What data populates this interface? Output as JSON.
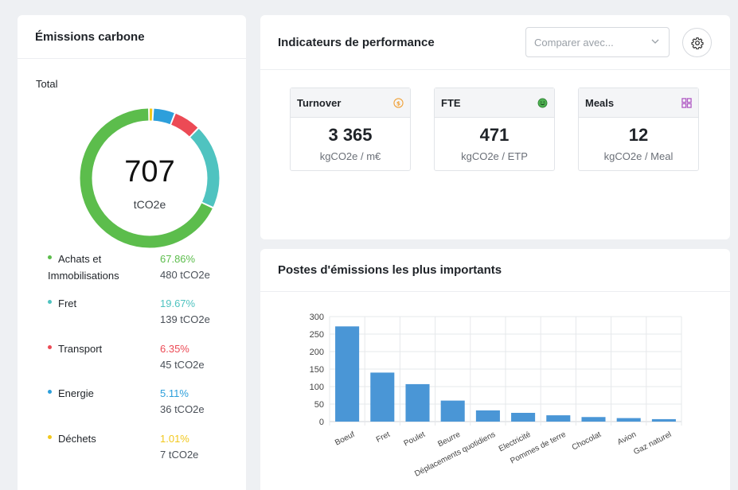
{
  "emissions": {
    "title": "Émissions carbone",
    "total_label": "Total",
    "total_value": "707",
    "total_unit": "tCO2e",
    "items": [
      {
        "name": "Achats et Immobilisations",
        "pct": "67.86%",
        "abs": "480 tCO2e",
        "color": "#5cbd4c",
        "share": 0.6786
      },
      {
        "name": "Fret",
        "pct": "19.67%",
        "abs": "139 tCO2e",
        "color": "#4fc3c0",
        "share": 0.1967
      },
      {
        "name": "Transport",
        "pct": "6.35%",
        "abs": "45 tCO2e",
        "color": "#ec4a55",
        "share": 0.0635
      },
      {
        "name": "Energie",
        "pct": "5.11%",
        "abs": "36 tCO2e",
        "color": "#2d9fdb",
        "share": 0.0511
      },
      {
        "name": "Déchets",
        "pct": "1.01%",
        "abs": "7 tCO2e",
        "color": "#f2c81d",
        "share": 0.0101
      }
    ]
  },
  "kpi": {
    "title": "Indicateurs de performance",
    "compare_placeholder": "Comparer avec...",
    "settings_icon": "gear-icon",
    "cards": [
      {
        "label": "Turnover",
        "value": "3 365",
        "unit": "kgCO2e / m€",
        "icon": "dollar-coin-icon",
        "icon_color": "#f0a23a"
      },
      {
        "label": "FTE",
        "value": "471",
        "unit": "kgCO2e / ETP",
        "icon": "smiley-icon",
        "icon_color": "#4caf50"
      },
      {
        "label": "Meals",
        "value": "12",
        "unit": "kgCO2e / Meal",
        "icon": "grid-icon",
        "icon_color": "#b05bc4"
      }
    ]
  },
  "postes": {
    "title": "Postes d'émissions les plus importants"
  },
  "chart_data": {
    "type": "bar",
    "title": "",
    "xlabel": "",
    "ylabel": "",
    "ylim": [
      0,
      300
    ],
    "yticks": [
      0,
      50,
      100,
      150,
      200,
      250,
      300
    ],
    "grid": true,
    "categories": [
      "Boeuf",
      "Fret",
      "Poulet",
      "Beurre",
      "Déplacements quotidiens",
      "Electricité",
      "Pommes de terre",
      "Chocolat",
      "Avion",
      "Gaz naturel"
    ],
    "values": [
      272,
      140,
      107,
      60,
      32,
      25,
      18,
      13,
      10,
      7
    ],
    "bar_color": "#4a96d6"
  }
}
